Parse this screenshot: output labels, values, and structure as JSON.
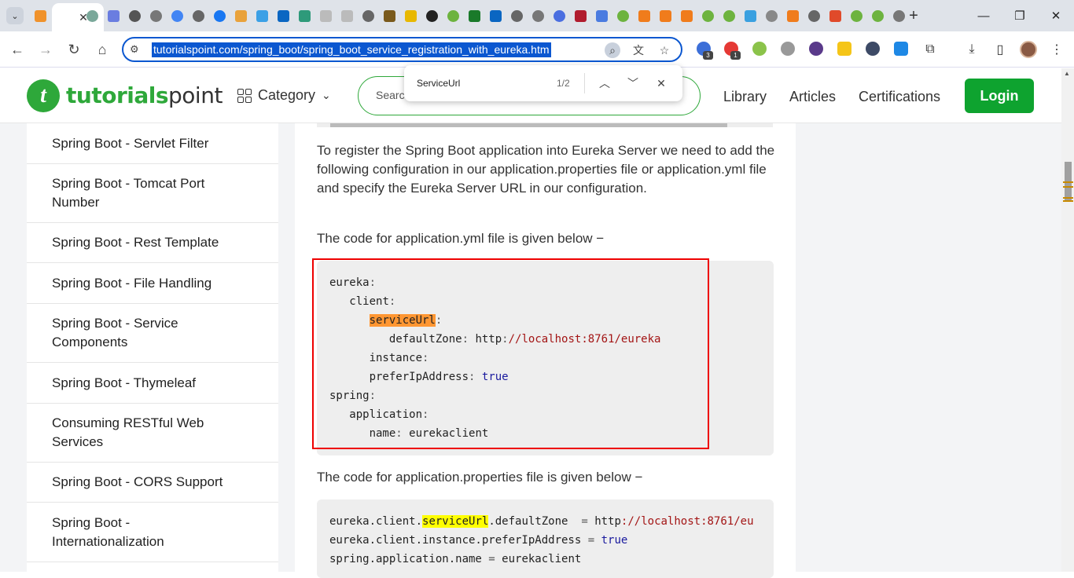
{
  "browser": {
    "url": "tutorialspoint.com/spring_boot/spring_boot_service_registration_with_eureka.htm",
    "find": {
      "query": "ServiceUrl",
      "count": "1/2"
    }
  },
  "site": {
    "logo_a": "tutorials",
    "logo_b": "point",
    "category": "Category",
    "search_placeholder": "Search",
    "nav": [
      "Library",
      "Articles",
      "Certifications"
    ],
    "login": "Login"
  },
  "sidebar": {
    "items": [
      "Spring Boot - Servlet Filter",
      "Spring Boot - Tomcat Port Number",
      "Spring Boot - Rest Template",
      "Spring Boot - File Handling",
      "Spring Boot - Service Components",
      "Spring Boot - Thymeleaf",
      "Consuming RESTful Web Services",
      "Spring Boot - CORS Support",
      "Spring Boot - Internationalization"
    ]
  },
  "content": {
    "para1": "To register the Spring Boot application into Eureka Server we need to add the following configuration in our application.properties file or application.yml file and specify the Eureka Server URL in our configuration.",
    "para2": "The code for application.yml file is given below −",
    "para3": "The code for application.properties file is given below −",
    "yml": {
      "eureka": "eureka",
      "client": "client",
      "serviceUrl": "serviceUrl",
      "defaultZone_key": "defaultZone",
      "defaultZone_val_a": "http",
      "defaultZone_val_b": "//localhost:8761/eureka",
      "instance": "instance",
      "preferIp_key": "preferIpAddress",
      "preferIp_val": "true",
      "spring": "spring",
      "application": "application",
      "name_key": "name",
      "name_val": "eurekaclient"
    },
    "props": {
      "l1_a": "eureka.client.",
      "l1_hl": "serviceUrl",
      "l1_b": ".defaultZone  ",
      "l1_eq": "=",
      "l1_c": " http",
      "l1_d": "://localhost:8761/eu",
      "l2_a": "eureka.client.instance.preferIpAddress ",
      "l2_eq": "=",
      "l2_val": " true",
      "l3_a": "spring.application.name ",
      "l3_eq": "=",
      "l3_val": " eurekaclient"
    }
  },
  "colors": {
    "brand_green": "#2ea83a",
    "login_green": "#0ea32f",
    "find_highlight_active": "#ff9632",
    "find_highlight": "#ffff00",
    "annotation_red": "#e00000"
  }
}
